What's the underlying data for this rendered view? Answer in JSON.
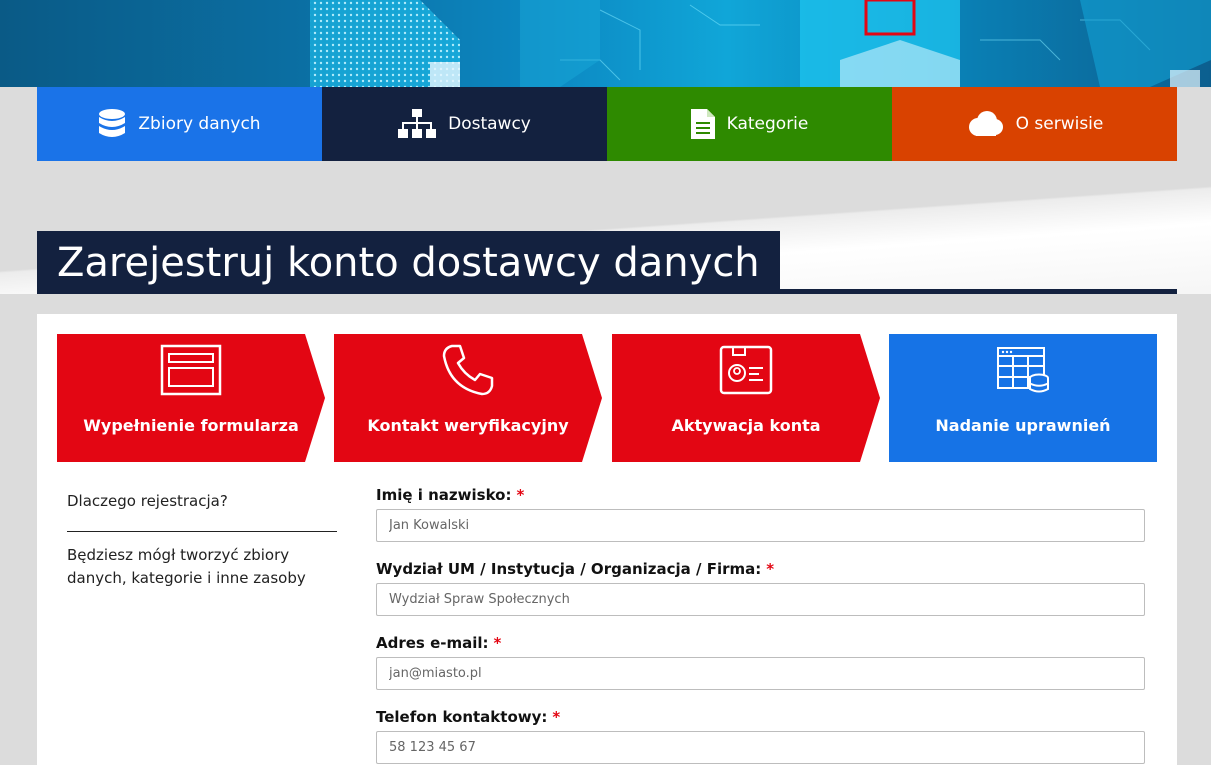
{
  "nav": [
    {
      "label": "Zbiory danych",
      "icon": "database-icon",
      "color": "#1a73e8"
    },
    {
      "label": "Dostawcy",
      "icon": "sitemap-icon",
      "color": "#13213f"
    },
    {
      "label": "Kategorie",
      "icon": "file-icon",
      "color": "#2e8a00"
    },
    {
      "label": "O serwisie",
      "icon": "cloud-icon",
      "color": "#d94200"
    }
  ],
  "page_title": "Zarejestruj konto dostawcy danych",
  "steps": [
    {
      "label": "Wypełnienie formularza",
      "icon": "form-icon",
      "color": "#e30613"
    },
    {
      "label": "Kontakt weryfikacyjny",
      "icon": "phone-icon",
      "color": "#e30613"
    },
    {
      "label": "Aktywacja konta",
      "icon": "id-card-icon",
      "color": "#e30613"
    },
    {
      "label": "Nadanie uprawnień",
      "icon": "table-database-icon",
      "color": "#1673e6"
    }
  ],
  "sidebar": {
    "title": "Dlaczego rejestracja?",
    "text": "Będziesz mógł tworzyć zbiory danych, kategorie i inne zasoby"
  },
  "form": {
    "fields": [
      {
        "label": "Imię i nazwisko:",
        "required": "*",
        "placeholder": "Jan Kowalski"
      },
      {
        "label": "Wydział UM / Instytucja / Organizacja / Firma:",
        "required": "*",
        "placeholder": "Wydział Spraw Społecznych"
      },
      {
        "label": "Adres e-mail:",
        "required": "*",
        "placeholder": "jan@miasto.pl"
      },
      {
        "label": "Telefon kontaktowy:",
        "required": "*",
        "placeholder": "58 123 45 67"
      }
    ]
  }
}
